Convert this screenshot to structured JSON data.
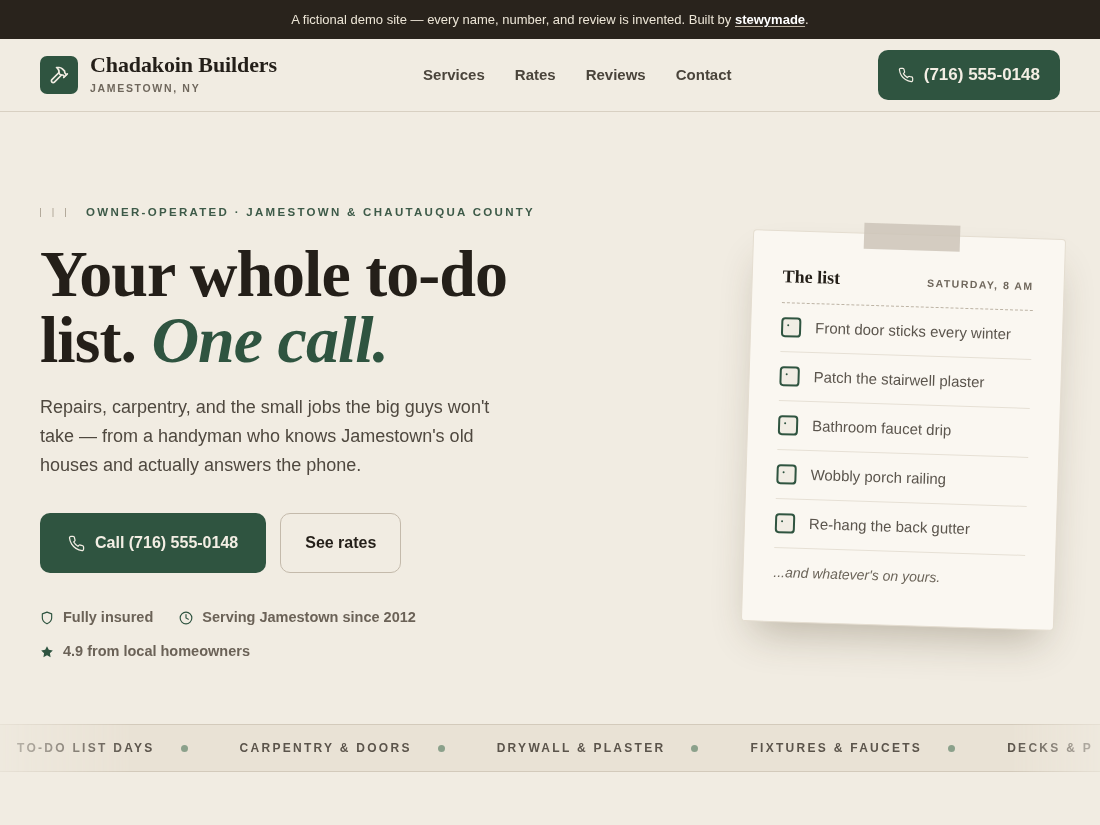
{
  "banner": {
    "text": "A fictional demo site — every name, number, and review is invented. Built by",
    "link": "stewymade",
    "suffix": "."
  },
  "header": {
    "brand": {
      "name": "Chadakoin Builders",
      "location": "JAMESTOWN, NY"
    },
    "nav": [
      "Services",
      "Rates",
      "Reviews",
      "Contact"
    ],
    "phone_button": "(716) 555-0148"
  },
  "hero": {
    "eyebrow": "OWNER-OPERATED · JAMESTOWN & CHAUTAUQUA COUNTY",
    "headline_lines": [
      "Your whole to-do",
      "list. *One call.*"
    ],
    "lede": "Repairs, carpentry, and the small jobs the big guys won't take — from a handyman who knows Jamestown's old houses and actually answers the phone.",
    "buttons": [
      {
        "label": "Call (716) 555-0148",
        "kind": "primary"
      },
      {
        "label": "See rates",
        "kind": "secondary"
      }
    ],
    "badges": [
      {
        "label": "Fully insured",
        "kind": "shield"
      },
      {
        "label": "Serving Jamestown since 2012",
        "kind": "clock"
      },
      {
        "label": "4.9 from local homeowners",
        "kind": "star"
      }
    ]
  },
  "note": {
    "title": "The list",
    "time": "SATURDAY, 8 AM",
    "items": [
      {
        "text": "Front door sticks every winter",
        "checked": false
      },
      {
        "text": "Patch the stairwell plaster",
        "checked": false
      },
      {
        "text": "Bathroom faucet drip",
        "checked": false
      },
      {
        "text": "Wobbly porch railing",
        "checked": false
      },
      {
        "text": "Re-hang the back gutter",
        "checked": false
      }
    ],
    "footer": "...and whatever's on yours."
  },
  "marquee": {
    "items": [
      "TO-DO LIST DAYS",
      "CARPENTRY & DOORS",
      "DRYWALL & PLASTER",
      "FIXTURES & FAUCETS",
      "DECKS & P"
    ]
  }
}
